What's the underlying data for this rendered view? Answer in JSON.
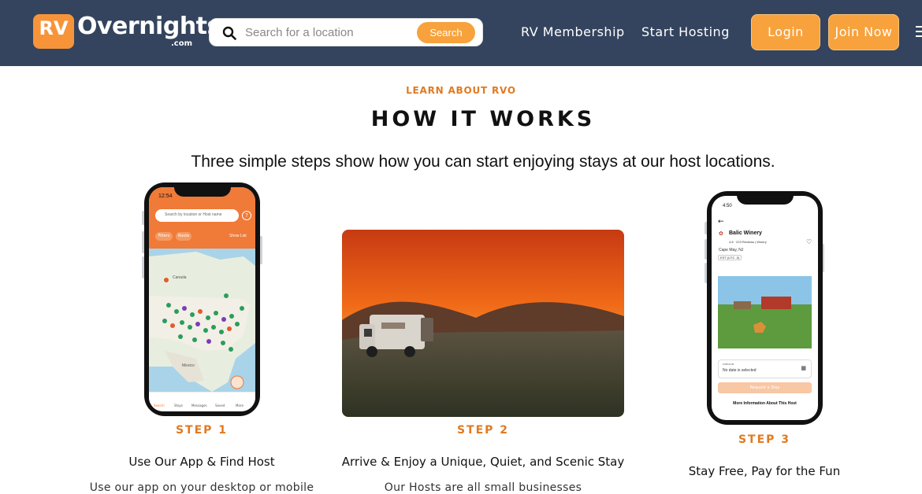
{
  "brand": {
    "logo_mark": "RV",
    "logo_word": "Overnights",
    "logo_suffix": ".com"
  },
  "search": {
    "placeholder": "Search for a location",
    "button_label": "Search",
    "icon": "search-icon"
  },
  "nav": {
    "items": [
      "RV Membership",
      "Start Hosting"
    ],
    "login_label": "Login",
    "join_label": "Join Now",
    "menu_icon": "hamburger-icon"
  },
  "section": {
    "eyebrow": "LEARN ABOUT RVO",
    "title": "HOW IT WORKS",
    "subtitle": "Three simple steps show how you can start enjoying stays at our host locations."
  },
  "steps": [
    {
      "label": "STEP 1",
      "title": "Use Our App & Find Host",
      "desc": "Use our app on your desktop or mobile"
    },
    {
      "label": "STEP 2",
      "title": "Arrive & Enjoy a Unique, Quiet, and Scenic Stay",
      "desc": "Our Hosts are all small businesses"
    },
    {
      "label": "STEP 3",
      "title": "Stay Free, Pay for the Fun",
      "desc": ""
    }
  ],
  "phone1": {
    "time": "12:54",
    "search_placeholder": "Search by location or Host name",
    "chips": [
      "Filters",
      "Route"
    ],
    "show_list": "Show List",
    "map_labels": [
      "Canada",
      "Mexico"
    ],
    "tabs": [
      "Search",
      "Stays",
      "Messages",
      "Saved",
      "More"
    ]
  },
  "phone2": {
    "time": "4:50",
    "host_name": "Balic Winery",
    "rating_line": "4.8 · 223 Reviews | Winery",
    "location": "Cape May, NJ",
    "timezone": "EST (UTC -5)",
    "checkin_label": "CHECK-IN",
    "checkin_value": "No date is selected",
    "request_button": "Request a Stay",
    "more_info": "More Information About This Host"
  },
  "colors": {
    "header_bg": "#34445e",
    "accent": "#f7a23c",
    "accent_text": "#e07a22"
  }
}
